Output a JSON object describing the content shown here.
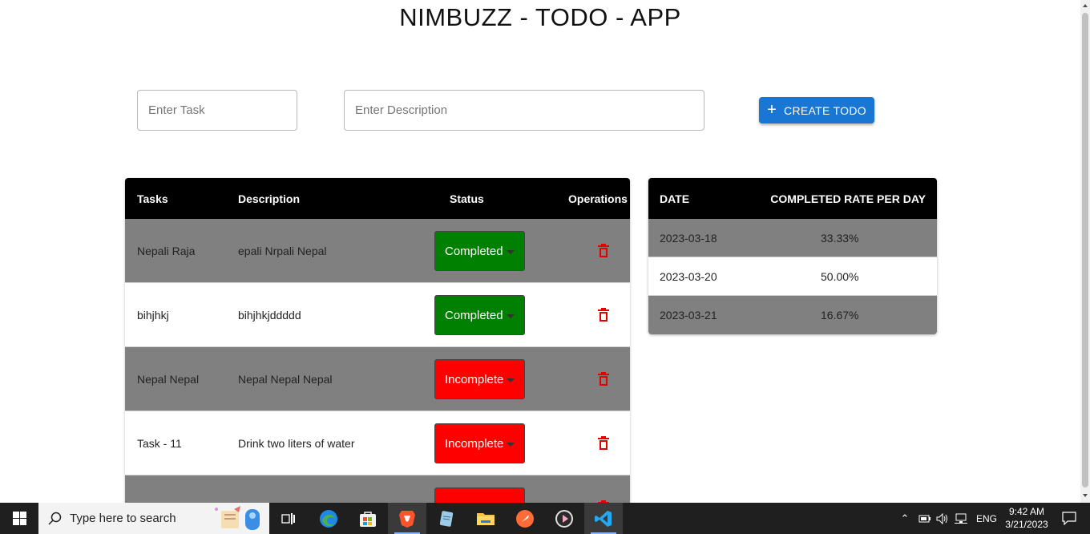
{
  "app": {
    "title": "NIMBUZZ - TODO - APP"
  },
  "form": {
    "task_placeholder": "Enter Task",
    "description_placeholder": "Enter Description",
    "create_label": "CREATE TODO"
  },
  "todo_table": {
    "headers": {
      "tasks": "Tasks",
      "description": "Description",
      "status": "Status",
      "operations": "Operations"
    },
    "rows": [
      {
        "task": "Nepali Raja",
        "description": "epali Nrpali Nepal",
        "status": "Completed"
      },
      {
        "task": "bihjhkj",
        "description": "bihjhkjddddd",
        "status": "Completed"
      },
      {
        "task": "Nepal Nepal",
        "description": "Nepal Nepal Nepal",
        "status": "Incomplete"
      },
      {
        "task": "Task - 11",
        "description": "Drink two liters of water",
        "status": "Incomplete"
      },
      {
        "task": "",
        "description": "",
        "status": ""
      }
    ]
  },
  "stats_table": {
    "headers": {
      "date": "DATE",
      "rate": "COMPLETED RATE PER DAY"
    },
    "rows": [
      {
        "date": "2023-03-18",
        "rate": "33.33%"
      },
      {
        "date": "2023-03-20",
        "rate": "50.00%"
      },
      {
        "date": "2023-03-21",
        "rate": "16.67%"
      }
    ]
  },
  "colors": {
    "completed": "#008000",
    "incomplete": "#ff0000",
    "primary": "#1976d2",
    "row_gray": "#808080",
    "header": "#000000"
  },
  "taskbar": {
    "search_placeholder": "Type here to search",
    "language": "ENG",
    "time": "9:42 AM",
    "date": "3/21/2023",
    "icons": [
      "windows-icon",
      "search-icon",
      "task-view-icon",
      "edge-icon",
      "store-icon",
      "brave-icon",
      "notepad-icon",
      "file-explorer-icon",
      "postman-icon",
      "media-player-icon",
      "vscode-icon"
    ]
  }
}
